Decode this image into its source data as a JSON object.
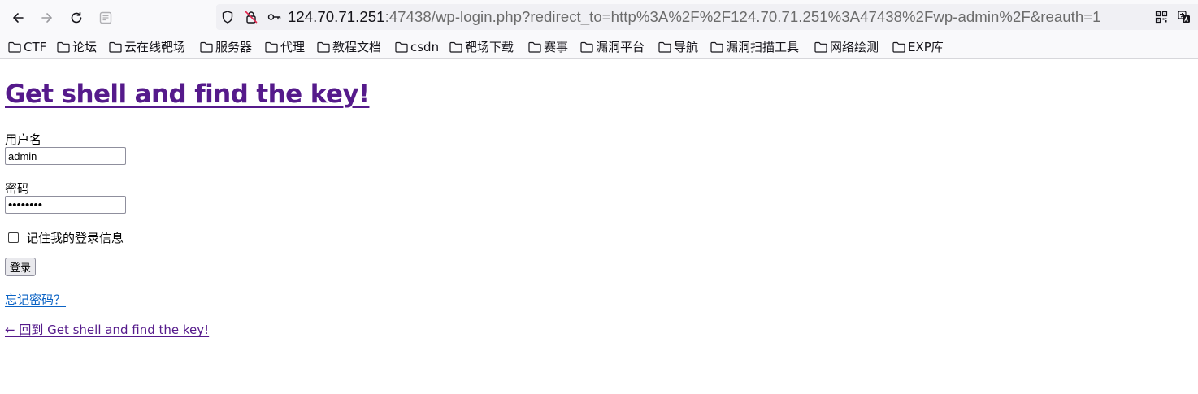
{
  "browser": {
    "url_host": "124.70.71.251",
    "url_rest": ":47438/wp-login.php?redirect_to=http%3A%2F%2F124.70.71.251%3A47438%2Fwp-admin%2F&reauth=1",
    "icons": [
      "back-icon",
      "forward-icon",
      "reload-icon",
      "reader-icon",
      "shield-icon",
      "insecure-lock-icon",
      "key-icon",
      "qr-code-icon",
      "translate-icon"
    ]
  },
  "bookmarks": [
    {
      "label": "CTF"
    },
    {
      "label": "论坛"
    },
    {
      "label": "云在线靶场"
    },
    {
      "label": "服务器"
    },
    {
      "label": "代理"
    },
    {
      "label": "教程文档"
    },
    {
      "label": "csdn"
    },
    {
      "label": "靶场下载"
    },
    {
      "label": "赛事"
    },
    {
      "label": "漏洞平台"
    },
    {
      "label": "导航"
    },
    {
      "label": "漏洞扫描工具"
    },
    {
      "label": "网络绘测"
    },
    {
      "label": "EXP库"
    }
  ],
  "page": {
    "site_title": "Get shell and find the key!",
    "username_label": "用户名",
    "username_value": "admin",
    "password_label": "密码",
    "password_value": "••••••••",
    "remember_label": "记住我的登录信息",
    "submit_label": "登录",
    "lost_password": "忘记密码？",
    "back_link": "← 回到 Get shell and find the key!"
  },
  "colors": {
    "visited_link": "#551a8b",
    "link": "#0b63c5",
    "toolbar_bg": "#f9f9fb",
    "urlbar_bg": "#f0f0f4"
  }
}
